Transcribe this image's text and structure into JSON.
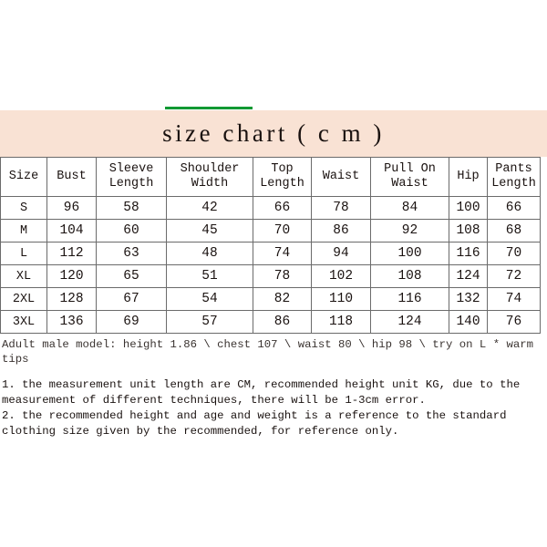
{
  "banner": {
    "title": "size chart ( c m )",
    "background_color": "#f9e2d4",
    "accent_bar_color": "#119933"
  },
  "table": {
    "headers": [
      {
        "line1": "Size",
        "line2": ""
      },
      {
        "line1": "Bust",
        "line2": ""
      },
      {
        "line1": "Sleeve",
        "line2": "Length"
      },
      {
        "line1": "Shoulder",
        "line2": "Width"
      },
      {
        "line1": "Top",
        "line2": "Length"
      },
      {
        "line1": "Waist",
        "line2": ""
      },
      {
        "line1": "Pull On",
        "line2": "Waist"
      },
      {
        "line1": "Hip",
        "line2": ""
      },
      {
        "line1": "Pants",
        "line2": "Length"
      }
    ],
    "rows": [
      {
        "size": "S",
        "bust": "96",
        "sleeve_length": "58",
        "shoulder_width": "42",
        "top_length": "66",
        "waist": "78",
        "pull_on_waist": "84",
        "hip": "100",
        "pants_length": "66"
      },
      {
        "size": "M",
        "bust": "104",
        "sleeve_length": "60",
        "shoulder_width": "45",
        "top_length": "70",
        "waist": "86",
        "pull_on_waist": "92",
        "hip": "108",
        "pants_length": "68"
      },
      {
        "size": "L",
        "bust": "112",
        "sleeve_length": "63",
        "shoulder_width": "48",
        "top_length": "74",
        "waist": "94",
        "pull_on_waist": "100",
        "hip": "116",
        "pants_length": "70"
      },
      {
        "size": "XL",
        "bust": "120",
        "sleeve_length": "65",
        "shoulder_width": "51",
        "top_length": "78",
        "waist": "102",
        "pull_on_waist": "108",
        "hip": "124",
        "pants_length": "72"
      },
      {
        "size": "2XL",
        "bust": "128",
        "sleeve_length": "67",
        "shoulder_width": "54",
        "top_length": "82",
        "waist": "110",
        "pull_on_waist": "116",
        "hip": "132",
        "pants_length": "74"
      },
      {
        "size": "3XL",
        "bust": "136",
        "sleeve_length": "69",
        "shoulder_width": "57",
        "top_length": "86",
        "waist": "118",
        "pull_on_waist": "124",
        "hip": "140",
        "pants_length": "76"
      }
    ]
  },
  "footer": {
    "model_note": "Adult male model: height 1.86 \\ chest 107 \\ waist 80 \\ hip 98 \\ try on L * warm tips",
    "notes": [
      "1. the measurement unit length are CM, recommended height unit KG, due to the measurement of different techniques, there will be 1-3cm error.",
      "2. the recommended height and age and weight is a reference to the standard clothing size given by the recommended, for reference only."
    ]
  }
}
